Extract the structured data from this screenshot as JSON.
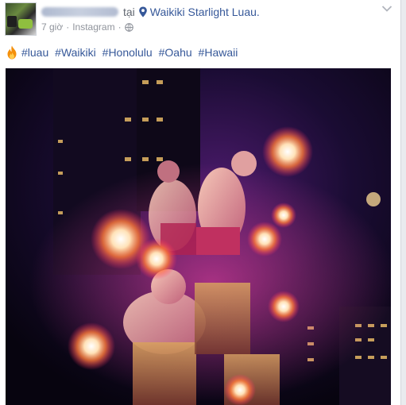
{
  "post": {
    "tai_text": "tại",
    "location": "Waikiki Starlight Luau.",
    "time": "7 giờ",
    "separator": "·",
    "source": "Instagram",
    "separator2": "·",
    "hashtags": [
      "#luau",
      "#Waikiki",
      "#Honolulu",
      "#Oahu",
      "#Hawaii"
    ]
  },
  "icons": {
    "location": "map-pin-icon",
    "privacy": "globe-icon",
    "menu": "chevron-down-icon",
    "emoji": "fire-icon"
  },
  "colors": {
    "link": "#365899",
    "meta": "#90949c"
  }
}
